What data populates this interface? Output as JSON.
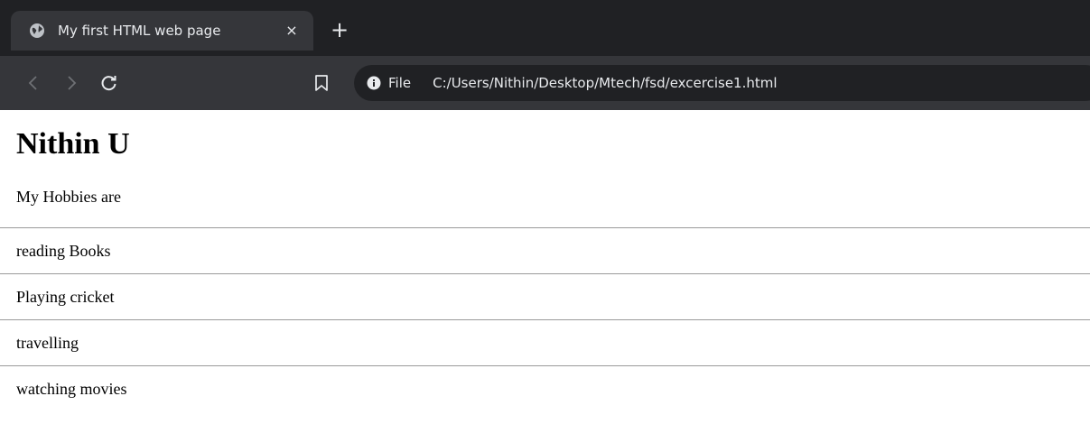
{
  "browser": {
    "tab": {
      "title": "My first HTML web page",
      "close_label": "×"
    },
    "new_tab_label": "+",
    "address": {
      "scheme_label": "File",
      "url": "C:/Users/Nithin/Desktop/Mtech/fsd/excercise1.html"
    },
    "icons": {
      "favicon": "globe-icon",
      "back": "back-arrow-icon",
      "forward": "forward-arrow-icon",
      "reload": "reload-icon",
      "bookmark": "bookmark-icon",
      "info": "info-icon"
    },
    "colors": {
      "tabstrip_bg": "#202124",
      "toolbar_bg": "#35363a",
      "text": "#e8eaed"
    }
  },
  "page": {
    "heading": "Nithin U",
    "intro": "My Hobbies are",
    "hobbies": [
      "reading Books",
      "Playing cricket",
      "travelling",
      "watching movies"
    ]
  }
}
